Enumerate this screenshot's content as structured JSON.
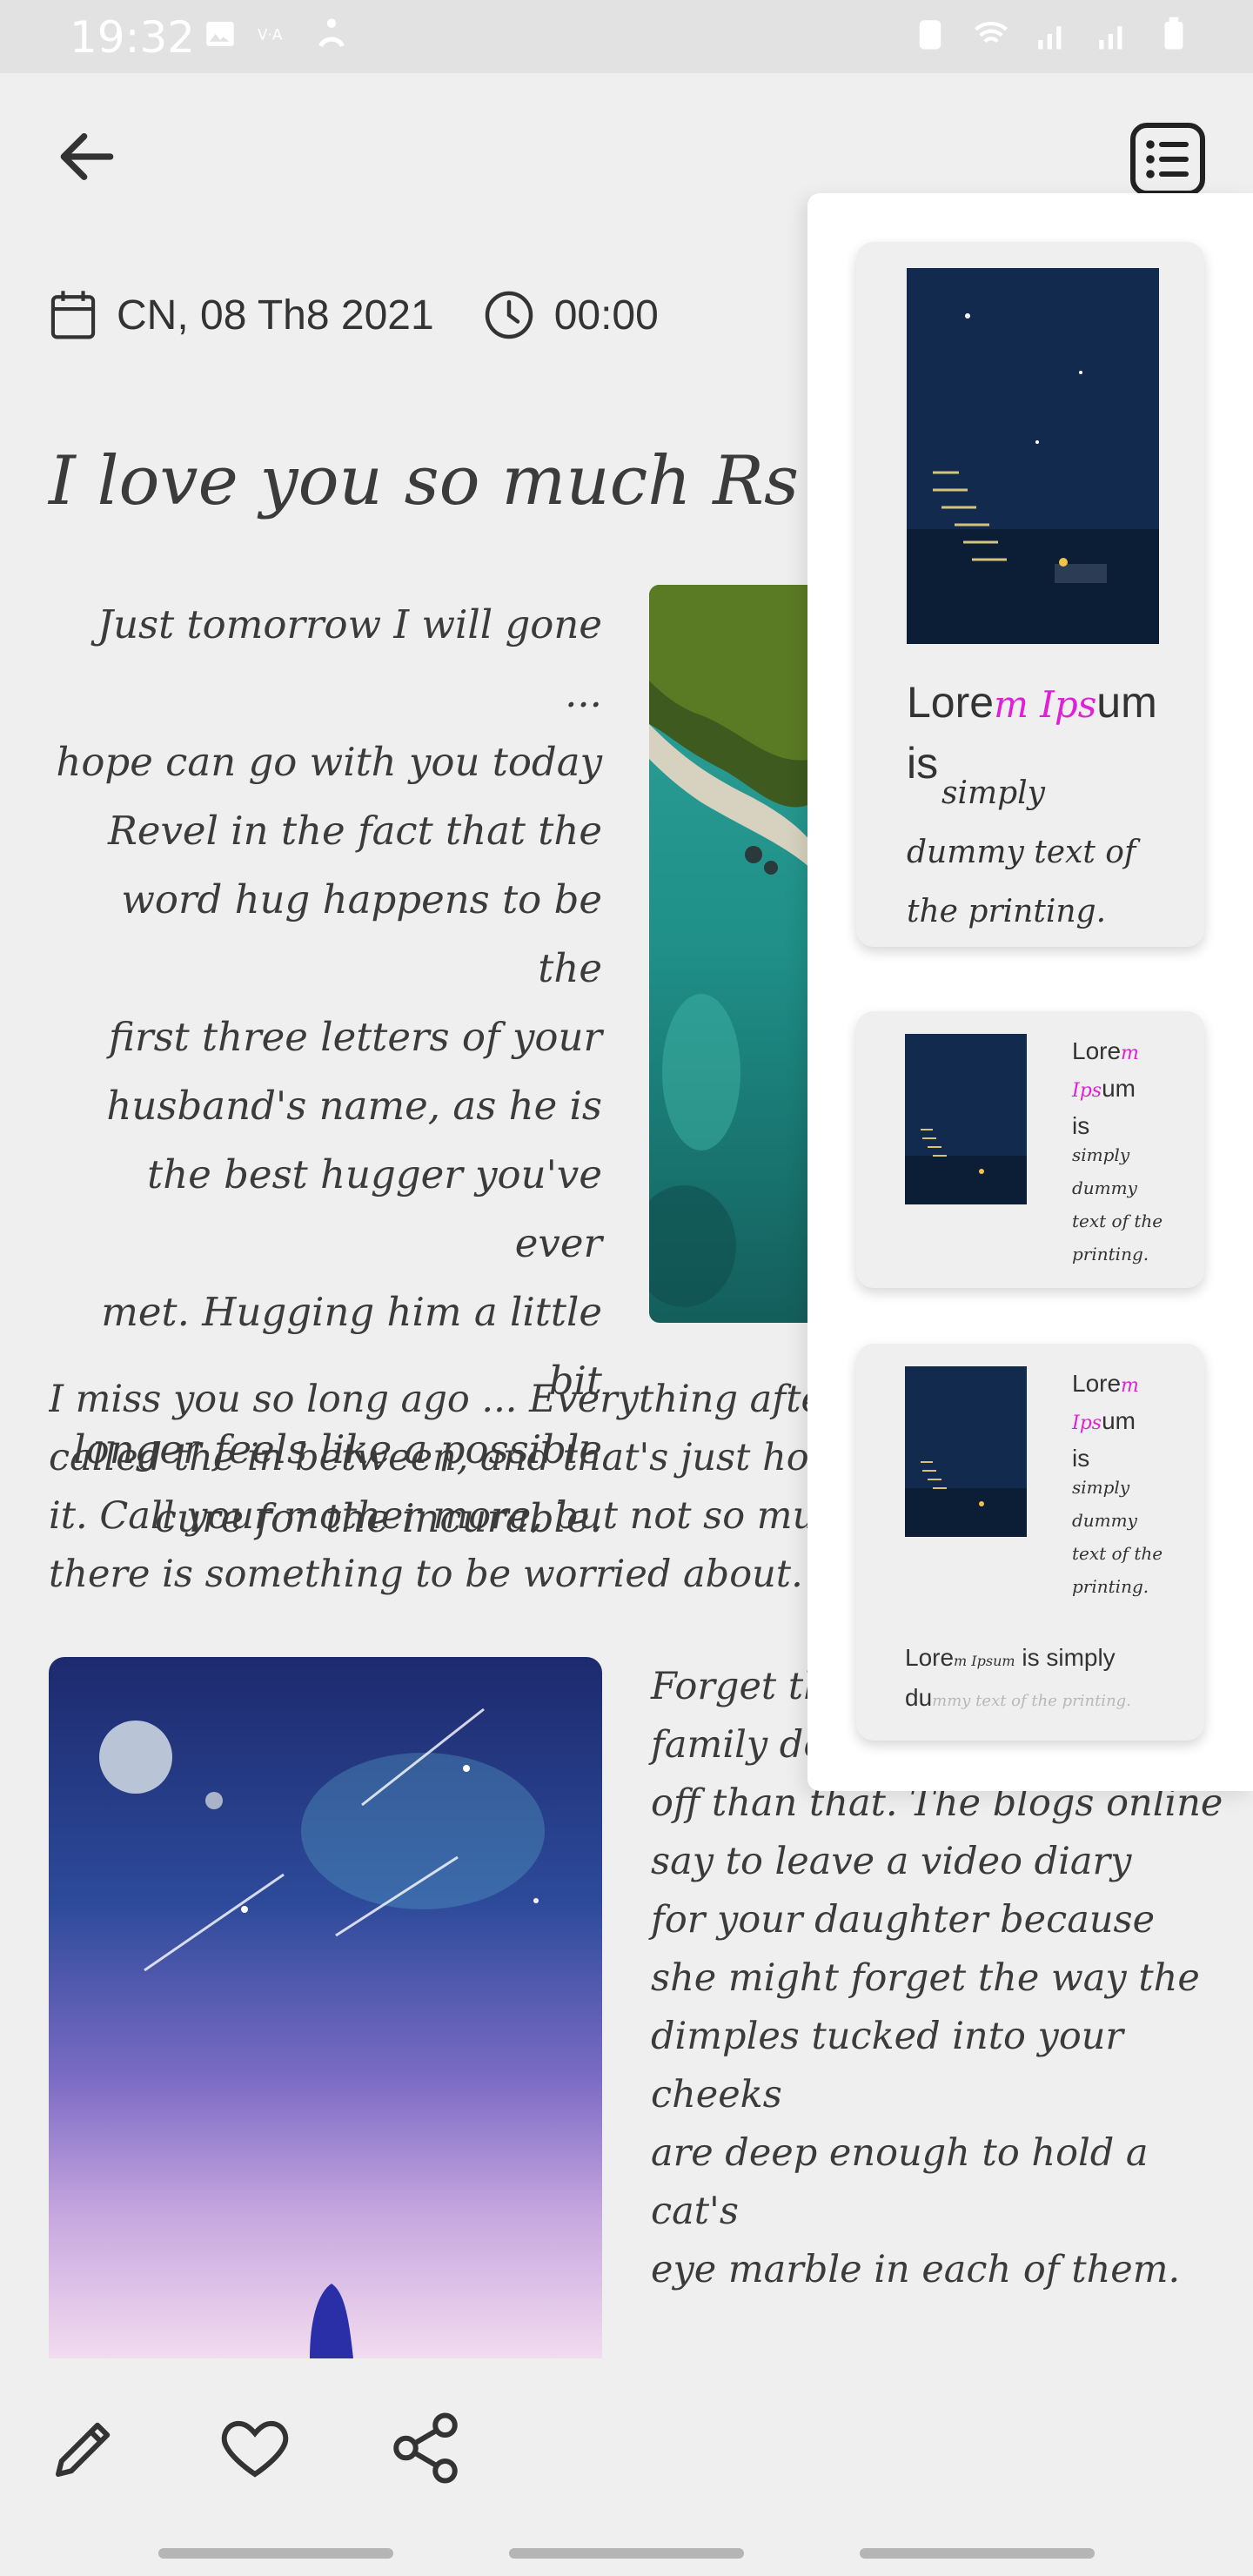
{
  "status_bar": {
    "time": "19:32",
    "left_icons": [
      "image-icon",
      "vpn-icon",
      "accessibility-icon"
    ],
    "right_icons": [
      "alarm-icon",
      "wifi-icon",
      "signal-icon",
      "signal-icon",
      "battery-icon"
    ]
  },
  "header": {
    "back_icon": "arrow-left-icon",
    "toc_icon": "list-icon"
  },
  "meta": {
    "date": "CN, 08 Th8 2021",
    "time": "00:00"
  },
  "post": {
    "title": "I love you so much Rs",
    "paragraph1": [
      "Just tomorrow I will gone ...",
      "hope can go with you today",
      "Revel in the fact that the",
      "word hug happens to be the",
      "first three letters of your",
      "husband's name, as he is",
      "the best hugger you've ever",
      "met. Hugging him a little bit",
      "longer feels like a possible",
      "cure for the incurable."
    ],
    "paragraph2": [
      "I miss you so long ago ... Everything after",
      "called the in between, and that's just how yo",
      "it. Call your mother more, but not so much",
      "there is something to be worried about. Mot"
    ],
    "paragraph3": [
      "Forget th",
      "family de",
      "off than that. The blogs online",
      "say to leave a video diary",
      "for your daughter because",
      "she might forget the way the",
      "dimples tucked into your cheeks",
      "are deep enough to hold a cat's",
      "eye marble in each of them."
    ]
  },
  "templates": {
    "card1": {
      "lorem_a": "Lore",
      "accent": "m Ips",
      "lorem_b": "um",
      "line2": "is",
      "script": [
        "simply",
        "dummy text of",
        "the printing."
      ]
    },
    "card2": {
      "lorem_a": "Lore",
      "accent_a": "m",
      "accent_b": "Ips",
      "lorem_b": "um",
      "line3": "is",
      "script": [
        "simply",
        "dummy",
        "text of the",
        "printing."
      ]
    },
    "card3": {
      "lorem_a": "Lore",
      "accent_a": "m",
      "accent_b": "Ips",
      "lorem_b": "um",
      "line3": "is",
      "script": [
        "simply",
        "dummy",
        "text of the",
        "printing."
      ],
      "footer_a": "Lore",
      "footer_accent": "m Ipsum",
      "footer_b": " is simply",
      "footer_c": "du",
      "footer_faded": "mmy text of the printing."
    }
  },
  "actions": {
    "edit_icon": "pencil-icon",
    "like_icon": "heart-icon",
    "share_icon": "share-icon"
  },
  "colors": {
    "background": "#efefef",
    "accent": "#e020d8",
    "text": "#3a3a3a"
  }
}
